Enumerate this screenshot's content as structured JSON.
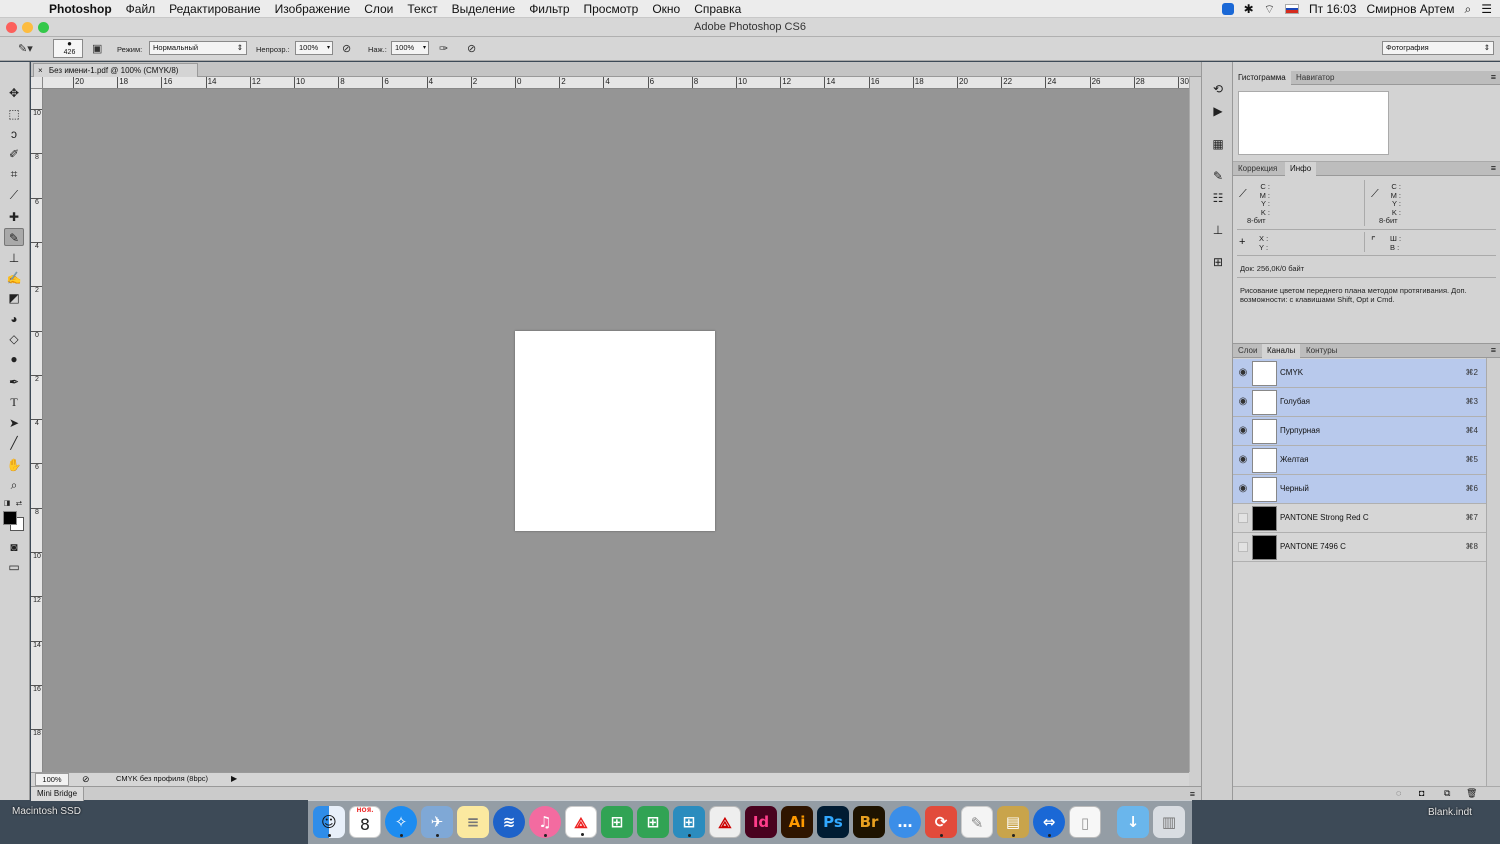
{
  "menubar": {
    "app_name": "Photoshop",
    "items": [
      "Файл",
      "Редактирование",
      "Изображение",
      "Слои",
      "Текст",
      "Выделение",
      "Фильтр",
      "Просмотр",
      "Окно",
      "Справка"
    ],
    "clock": "Пт 16:03",
    "user": "Смирнов Артем"
  },
  "window": {
    "title": "Adobe Photoshop CS6"
  },
  "options": {
    "brush_size": "426",
    "mode_label": "Режим:",
    "mode_value": "Нормальный",
    "opacity_label": "Непрозр.:",
    "opacity_value": "100%",
    "flow_label": "Наж.:",
    "flow_value": "100%",
    "workspace": "Фотография"
  },
  "document": {
    "tab_title": "Без имени-1.pdf @ 100% (CMYK/8)",
    "ruler_top": [
      "20",
      "18",
      "16",
      "14",
      "12",
      "10",
      "8",
      "6",
      "4",
      "2",
      "0",
      "2",
      "4",
      "6",
      "8",
      "10",
      "12",
      "14",
      "16",
      "18",
      "20",
      "22",
      "24",
      "26",
      "28",
      "30"
    ],
    "ruler_left": [
      "10",
      "8",
      "6",
      "4",
      "2",
      "0",
      "2",
      "4",
      "6",
      "8",
      "10",
      "12",
      "14",
      "16",
      "18"
    ],
    "zoom": "100%",
    "status_text": "CMYK без профиля (8bpc)"
  },
  "minibridge": {
    "label": "Mini Bridge"
  },
  "panels": {
    "top_tabs": [
      "Гистограмма",
      "Навигатор"
    ],
    "mid_tabs": [
      "Коррекция",
      "Инфо"
    ],
    "info": {
      "cmyk_left": [
        "C :",
        "M :",
        "Y :",
        "K :"
      ],
      "bit_left": "8-бит",
      "cmyk_right": [
        "C :",
        "M :",
        "Y :",
        "K :"
      ],
      "bit_right": "8-бит",
      "xy": [
        "X :",
        "Y :"
      ],
      "wh": [
        "Ш :",
        "В :"
      ],
      "doc_size": "Док: 256,0К/0 байт",
      "hint": "Рисование цветом переднего плана методом протягивания. Доп. возможности: с клавишами Shift, Opt и Cmd."
    },
    "bottom_tabs": [
      "Слои",
      "Каналы",
      "Контуры"
    ],
    "channels": [
      {
        "name": "CMYK",
        "shortcut": "⌘2"
      },
      {
        "name": "Голубая",
        "shortcut": "⌘3"
      },
      {
        "name": "Пурпурная",
        "shortcut": "⌘4"
      },
      {
        "name": "Желтая",
        "shortcut": "⌘5"
      },
      {
        "name": "Черный",
        "shortcut": "⌘6"
      },
      {
        "name": "PANTONE Strong Red C",
        "shortcut": "⌘7"
      },
      {
        "name": "PANTONE 7496 C",
        "shortcut": "⌘8"
      }
    ]
  },
  "desktop": {
    "disk_label": "Macintosh SSD",
    "file_label": "Blank.indt",
    "calendar_month": "НОЯ.",
    "calendar_day": "8",
    "app_labels": {
      "indesign": "Id",
      "illustrator": "Ai",
      "photoshop": "Ps",
      "bridge": "Br"
    }
  },
  "colors": {
    "canvas_bg": "#959595",
    "channel_selected": "#b8c9ec",
    "indesign": "#49021f",
    "illustrator": "#2f1500",
    "photoshop": "#001c33",
    "bridge": "#1e1300"
  }
}
